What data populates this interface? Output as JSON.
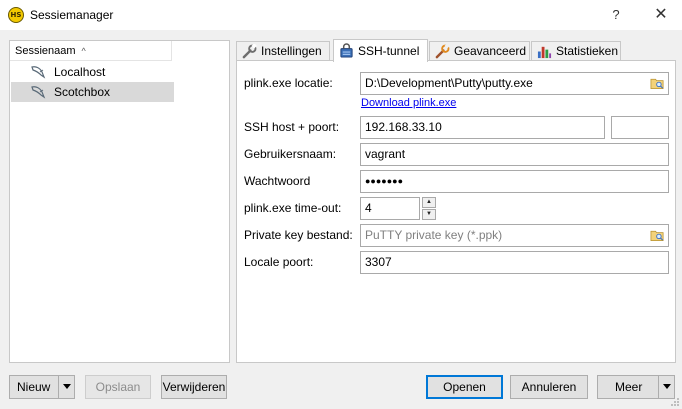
{
  "window": {
    "title": "Sessiemanager",
    "app_icon_text": "HS",
    "help_label": "?",
    "close_label": "✕"
  },
  "tree": {
    "header": "Sessienaam",
    "sort_indicator": "^",
    "items": [
      {
        "label": "Localhost",
        "selected": false
      },
      {
        "label": "Scotchbox",
        "selected": true
      }
    ]
  },
  "tabs": [
    {
      "label": "Instellingen",
      "icon": "wrench-icon",
      "active": false
    },
    {
      "label": "SSH-tunnel",
      "icon": "lock-icon",
      "active": true
    },
    {
      "label": "Geavanceerd",
      "icon": "wrench-advanced-icon",
      "active": false
    },
    {
      "label": "Statistieken",
      "icon": "bar-chart-icon",
      "active": false
    }
  ],
  "ssh": {
    "plink_label": "plink.exe locatie:",
    "plink_value": "D:\\Development\\Putty\\putty.exe",
    "download_link": "Download plink.exe",
    "host_label": "SSH host + poort:",
    "host_value": "192.168.33.10",
    "port_value": "",
    "user_label": "Gebruikersnaam:",
    "user_value": "vagrant",
    "password_label": "Wachtwoord",
    "password_value": "●●●●●●●",
    "timeout_label": "plink.exe time-out:",
    "timeout_value": "4",
    "key_label": "Private key bestand:",
    "key_placeholder": "PuTTY private key (*.ppk)",
    "local_port_label": "Locale poort:",
    "local_port_value": "3307"
  },
  "buttons": {
    "new": "Nieuw",
    "save": "Opslaan",
    "delete": "Verwijderen",
    "open": "Openen",
    "cancel": "Annuleren",
    "more": "Meer"
  }
}
